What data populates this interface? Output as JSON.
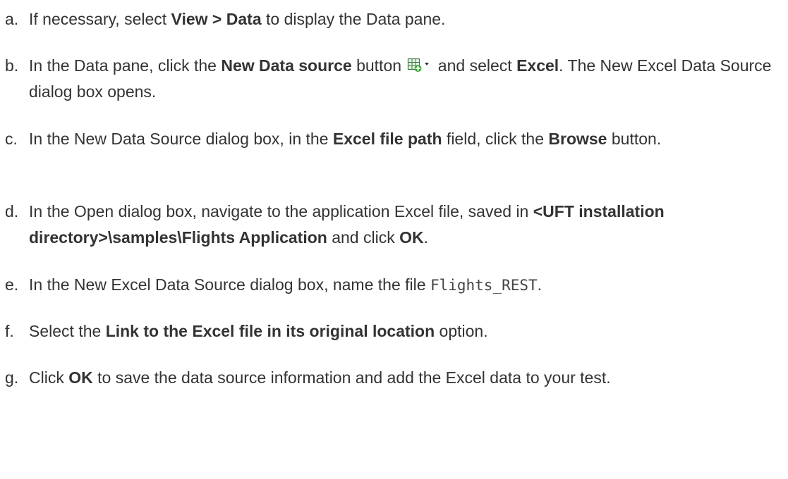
{
  "steps": [
    {
      "marker": "a.",
      "t1": "If necessary, select ",
      "b1": "View > Data",
      "t2": " to display the Data pane."
    },
    {
      "marker": "b.",
      "t1": "In the Data pane, click the ",
      "b1": "New Data source",
      "t2": " button ",
      "icon": "table-add-dropdown-icon",
      "t3": " and select ",
      "b2": "Excel",
      "t4": ". The New Excel Data Source dialog box opens."
    },
    {
      "marker": "c.",
      "t1": "In the New Data Source dialog box, in the ",
      "b1": "Excel file path",
      "t2": " field, click the ",
      "b2": "Browse",
      "t3": " button."
    },
    {
      "marker": "d.",
      "t1": "In the Open dialog box, navigate to the application Excel file, saved in ",
      "b1": "<UFT installation directory>\\samples\\Flights Application",
      "t2": " and click ",
      "b2": "OK",
      "t3": "."
    },
    {
      "marker": "e.",
      "t1": "In the New Excel Data Source dialog box, name the file ",
      "code": "Flights_REST",
      "t2": "."
    },
    {
      "marker": "f.",
      "t1": "Select the ",
      "b1": "Link to the Excel file in its original location",
      "t2": " option."
    },
    {
      "marker": "g.",
      "t1": "Click ",
      "b1": "OK",
      "t2": " to save the data source information and add the Excel data to your test."
    }
  ],
  "colors": {
    "text": "#333333",
    "icon_grid": "#3b7a3b",
    "icon_plus": "#3aa23a"
  }
}
